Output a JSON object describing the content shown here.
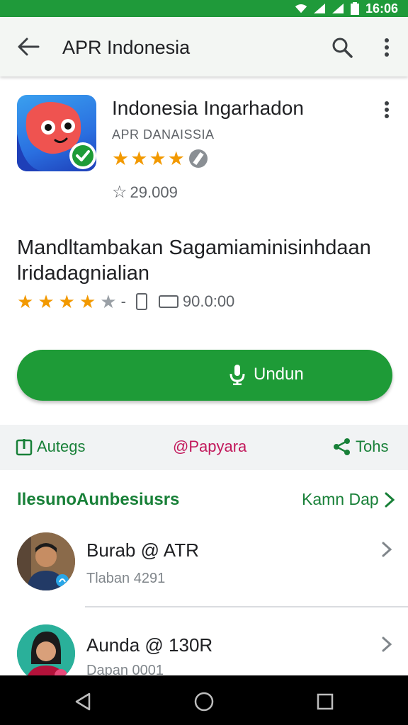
{
  "status_bar": {
    "time": "16:06"
  },
  "app_bar": {
    "title": "APR Indonesia"
  },
  "app": {
    "name": "Indonesia Ingarhadon",
    "developer": "APR DANAISSIA",
    "rating_count": "29.009",
    "rating_stars": 4
  },
  "description": {
    "title_line1": "Mandltambakan Sagamiaminisinhdaan",
    "title_line2": "lridadagnialian",
    "stars": 4,
    "dash": "-",
    "meta_value": "90.0:00"
  },
  "install": {
    "label": "Undun"
  },
  "actions": {
    "a1": "Autegs",
    "a2": "@Papyara",
    "a3": "Tohs"
  },
  "section": {
    "title": "llesunoAunbesiusrs",
    "link": "Kamn Dap"
  },
  "people": [
    {
      "name": "Burab @ ATR",
      "sub": "Tlaban 4291"
    },
    {
      "name": "Aunda @ 130R",
      "sub": "Dapan 0001"
    }
  ],
  "colors": {
    "primary_green": "#1e9b37",
    "status_green": "#1f9a3a",
    "star_orange": "#f29900",
    "accent_pink": "#c2185b"
  }
}
